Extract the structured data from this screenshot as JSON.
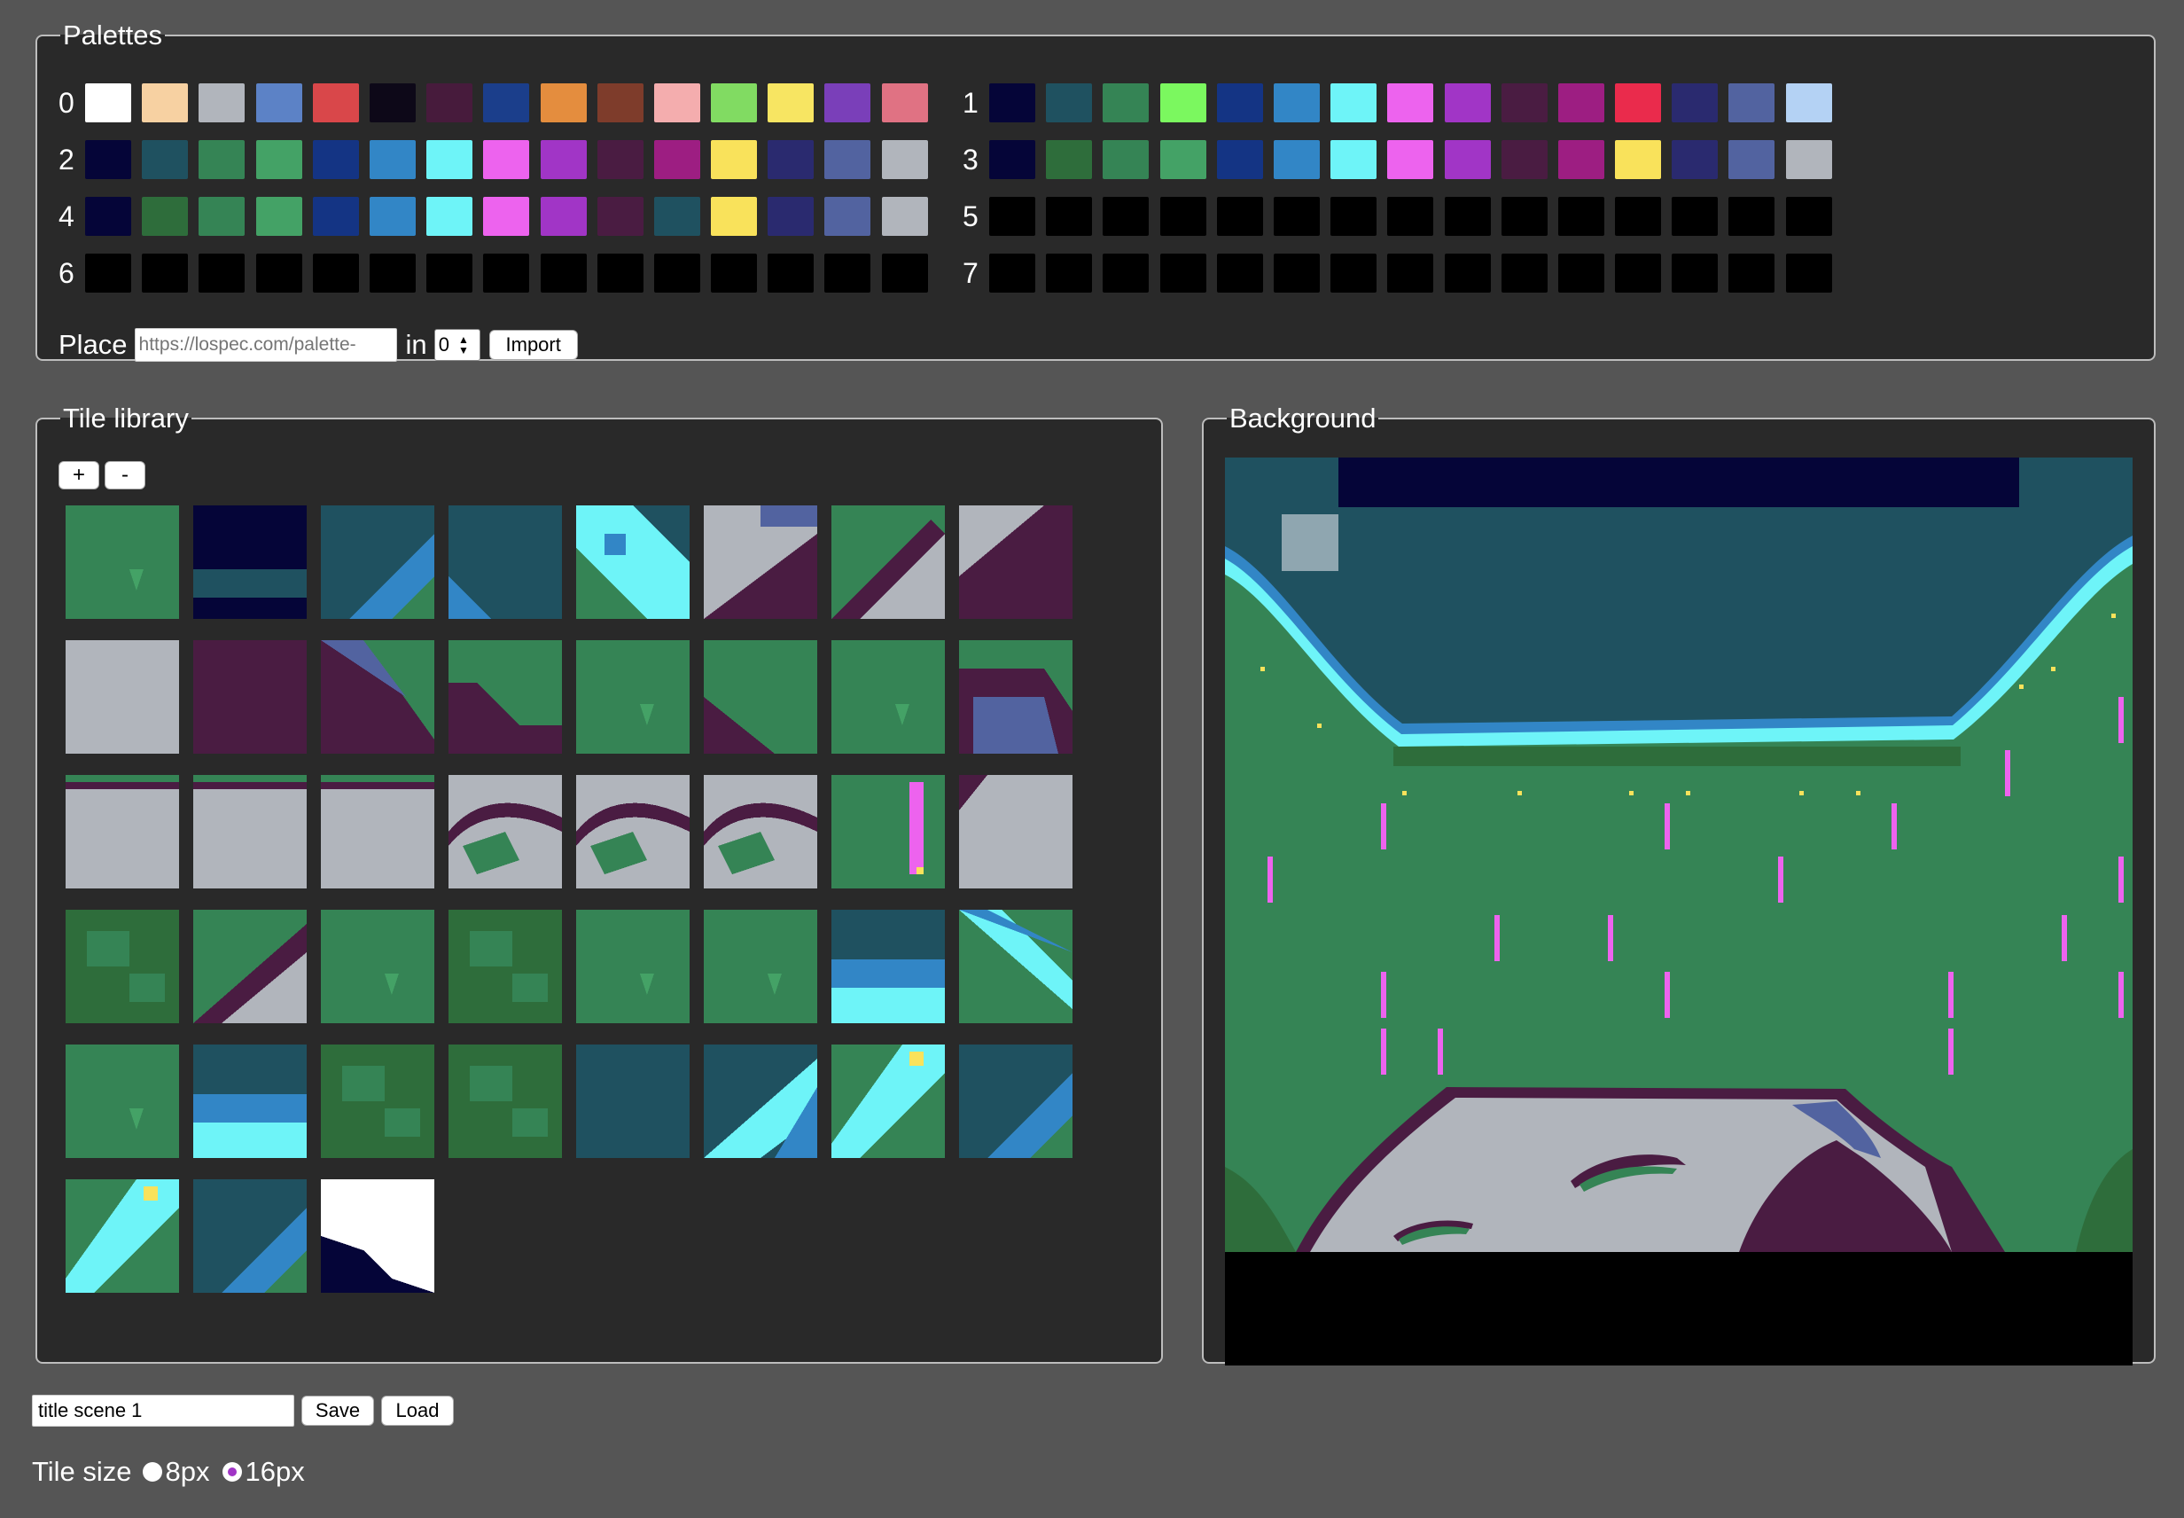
{
  "palettes": {
    "legend": "Palettes",
    "rows": [
      {
        "index": "0",
        "colors": [
          "#ffffff",
          "#f7d1a2",
          "#b1b5bc",
          "#5c82c6",
          "#d9474a",
          "#0d0818",
          "#471b3c",
          "#1b3e8b",
          "#e48d3e",
          "#7e3c2b",
          "#f4adae",
          "#81db62",
          "#f7e562",
          "#7a3fb9",
          "#e07283"
        ]
      },
      {
        "index": "1",
        "colors": [
          "#050538",
          "#1f5160",
          "#358455",
          "#7bf85f",
          "#143484",
          "#3286c6",
          "#6ef4f8",
          "#ed63ee",
          "#a135c6",
          "#4a1c42",
          "#9d1e82",
          "#ea2b4c",
          "#2a2a6f",
          "#5263a0",
          "#b4d2f4"
        ]
      },
      {
        "index": "2",
        "colors": [
          "#050538",
          "#1f5160",
          "#358455",
          "#44a266",
          "#143484",
          "#3286c6",
          "#6ef4f8",
          "#ed63ee",
          "#a135c6",
          "#4a1c42",
          "#9d1e82",
          "#f9e25b",
          "#2a2a6f",
          "#5263a0",
          "#b1b5bc"
        ]
      },
      {
        "index": "3",
        "colors": [
          "#050538",
          "#2e6d3b",
          "#358455",
          "#44a266",
          "#143484",
          "#3286c6",
          "#6ef4f8",
          "#ed63ee",
          "#a135c6",
          "#4a1c42",
          "#9d1e82",
          "#f9e25b",
          "#2a2a6f",
          "#5263a0",
          "#b1b5bc"
        ]
      },
      {
        "index": "4",
        "colors": [
          "#050538",
          "#2e6d3b",
          "#358455",
          "#44a266",
          "#143484",
          "#3286c6",
          "#6ef4f8",
          "#ed63ee",
          "#a135c6",
          "#4a1c42",
          "#1f5160",
          "#f9e25b",
          "#2a2a6f",
          "#5263a0",
          "#b1b5bc"
        ]
      },
      {
        "index": "5",
        "colors": [
          "#000000",
          "#000000",
          "#000000",
          "#000000",
          "#000000",
          "#000000",
          "#000000",
          "#000000",
          "#000000",
          "#000000",
          "#000000",
          "#000000",
          "#000000",
          "#000000",
          "#000000"
        ]
      },
      {
        "index": "6",
        "colors": [
          "#000000",
          "#000000",
          "#000000",
          "#000000",
          "#000000",
          "#000000",
          "#000000",
          "#000000",
          "#000000",
          "#000000",
          "#000000",
          "#000000",
          "#000000",
          "#000000",
          "#000000"
        ]
      },
      {
        "index": "7",
        "colors": [
          "#000000",
          "#000000",
          "#000000",
          "#000000",
          "#000000",
          "#000000",
          "#000000",
          "#000000",
          "#000000",
          "#000000",
          "#000000",
          "#000000",
          "#000000",
          "#000000",
          "#000000"
        ]
      }
    ],
    "import": {
      "place_label": "Place",
      "url_placeholder": "https://lospec.com/palette-",
      "in_label": "in",
      "slot_value": "0",
      "button": "Import"
    }
  },
  "tile_library": {
    "legend": "Tile library",
    "add_label": "+",
    "remove_label": "-",
    "tile_count": 43
  },
  "background": {
    "legend": "Background"
  },
  "scene": {
    "name_value": "title scene 1",
    "save_label": "Save",
    "load_label": "Load"
  },
  "tile_size": {
    "label": "Tile size",
    "options": [
      "8px",
      "16px"
    ],
    "selected": "16px"
  },
  "colors": {
    "page_bg": "#555555",
    "panel_bg": "#292929",
    "grass": "#358455",
    "grass_dark": "#2e6d3b",
    "grass_light": "#44a266",
    "water": "#1f5160",
    "water_mid": "#3286c6",
    "water_light": "#6ef4f8",
    "night": "#050538",
    "stone": "#b1b5bc",
    "dirt": "#4a1c42",
    "slate": "#5263a0",
    "flower": "#ed63ee",
    "spark": "#f9e25b",
    "radio_accent": "#a135c6"
  }
}
